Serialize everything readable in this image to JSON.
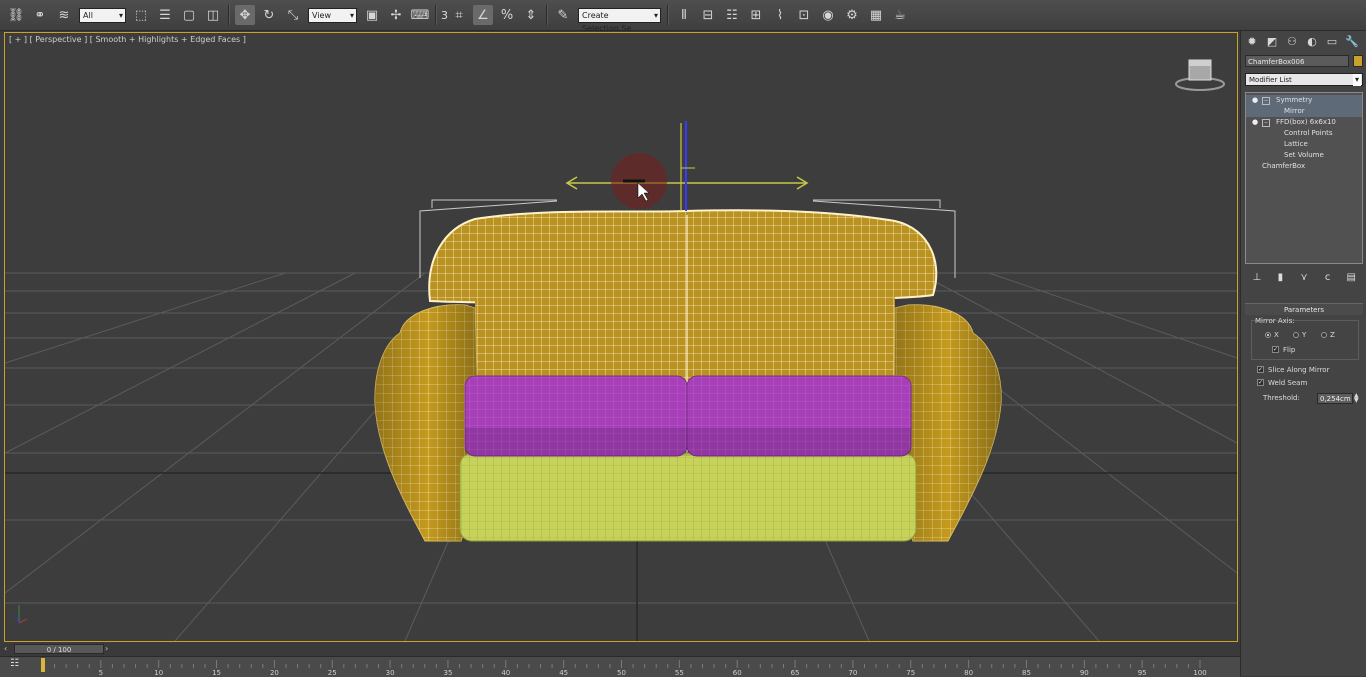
{
  "toolbar": {
    "selection_filter": "All",
    "reference_coord": "View",
    "snap_label": "3",
    "named_selection_placeholder": "Create Selection Se",
    "icons": [
      "link-icon",
      "unlink-icon",
      "bind-spacewarp-icon",
      "select-object-icon",
      "select-by-name-icon",
      "rect-select-icon",
      "window-crossing-icon",
      "select-move-icon",
      "select-rotate-icon",
      "select-scale-icon",
      "pivot-center-icon",
      "manipulate-icon",
      "keyboard-shortcut-icon",
      "snap-toggle-icon",
      "angle-snap-icon",
      "percent-snap-icon",
      "spinner-snap-icon",
      "edit-named-sel-icon",
      "mirror-icon",
      "align-icon",
      "layer-icon",
      "graphite-icon",
      "curve-editor-icon",
      "schematic-icon",
      "material-editor-icon",
      "render-setup-icon",
      "rendered-frame-icon",
      "render-icon"
    ]
  },
  "viewport": {
    "label": "[ + ] [ Perspective ] [ Smooth + Highlights + Edged Faces ]",
    "border_color": "#c9a227",
    "sofa_frame_color": "#c9a227",
    "cushion_color": "#a63fb8",
    "base_color": "#c6d25a"
  },
  "command_panel": {
    "object_name": "ChamferBox006",
    "object_color": "#c8a22a",
    "modifier_list": "Modifier List",
    "stack": [
      {
        "label": "Symmetry",
        "level": 0,
        "selected": true
      },
      {
        "label": "Mirror",
        "level": 1,
        "selected": true
      },
      {
        "label": "FFD(box) 6x6x10",
        "level": 0,
        "selected": false
      },
      {
        "label": "Control Points",
        "level": 1,
        "selected": false
      },
      {
        "label": "Lattice",
        "level": 1,
        "selected": false
      },
      {
        "label": "Set Volume",
        "level": 1,
        "selected": false
      },
      {
        "label": "ChamferBox",
        "level": 0,
        "selected": false
      }
    ],
    "parameters": {
      "title": "Parameters",
      "mirror_axis_label": "Mirror Axis:",
      "axis_x": "X",
      "axis_y": "Y",
      "axis_z": "Z",
      "selected_axis": "X",
      "flip_label": "Flip",
      "flip_checked": true,
      "slice_label": "Slice Along Mirror",
      "slice_checked": true,
      "weld_label": "Weld Seam",
      "weld_checked": true,
      "threshold_label": "Threshold:",
      "threshold_value": "0,254cm"
    }
  },
  "timeline": {
    "frame_display": "0 / 100",
    "ticks": [
      "5",
      "10",
      "15",
      "20",
      "25",
      "30",
      "35",
      "40",
      "45",
      "50",
      "55",
      "60",
      "65",
      "70",
      "75",
      "80",
      "85",
      "90",
      "95",
      "100"
    ]
  }
}
